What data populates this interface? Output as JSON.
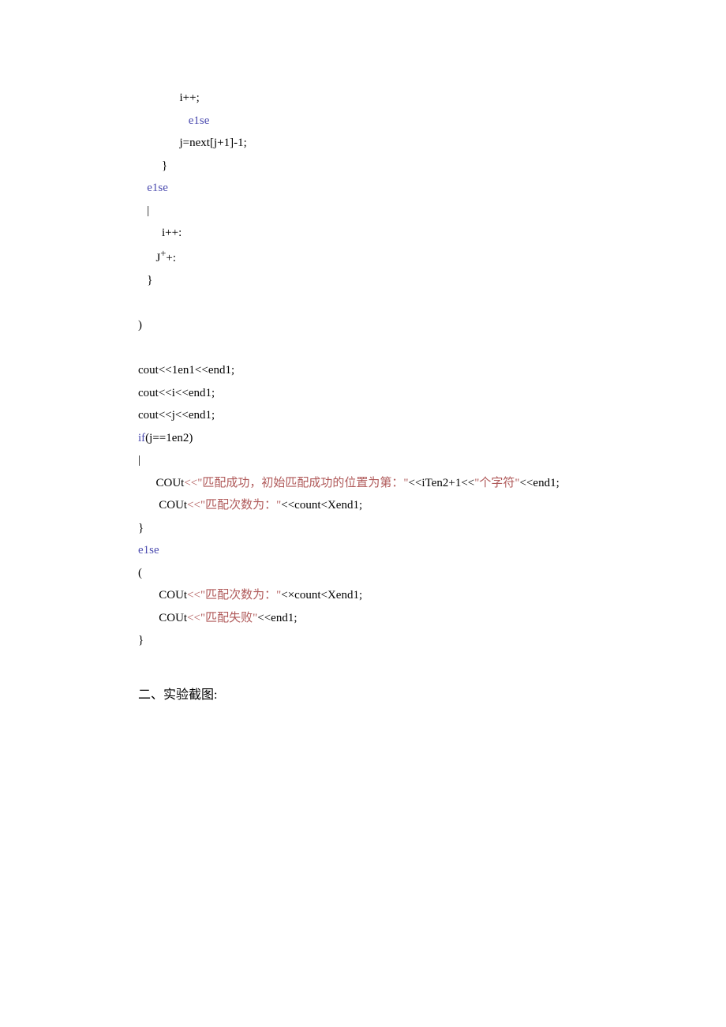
{
  "code": {
    "l01": "i++;",
    "l02_kw": "e1se",
    "l03": "j=next[j+1]-1;",
    "l04": "}",
    "l05_kw": "e1se",
    "l06": "|",
    "l07": "i++:",
    "l08": "J",
    "l08b": "+:",
    "l09": "}",
    "l10": ")",
    "l11": "cout<<1en1<<end1;",
    "l12": "cout<<i<<end1;",
    "l13": "cout<<j<<end1;",
    "l14_kw": "if",
    "l14": "(j==1en2)",
    "l15": "|",
    "l16a": "COUt",
    "l16op": "<<",
    "l16s1": "\"匹配成功，初始匹配成功的位置为第：\"",
    "l16b": "<<iTen2+1<<",
    "l16s2": "\"个字符\"",
    "l16c": "<<end1;",
    "l17a": "COUt",
    "l17op": "<<",
    "l17s": "\"匹配次数为：\"",
    "l17b": "<<count<Xend1;",
    "l18": "}",
    "l19_kw": "e1se",
    "l20": "(",
    "l21a": "COUt",
    "l21op": "<<",
    "l21s": "\"匹配次数为：\"",
    "l21b": "<×count<Xend1;",
    "l22a": "COUt",
    "l22op": "<<",
    "l22s": "\"匹配失败\"",
    "l22b": "<<end1;",
    "l23": "}"
  },
  "heading": "二、实验截图:"
}
